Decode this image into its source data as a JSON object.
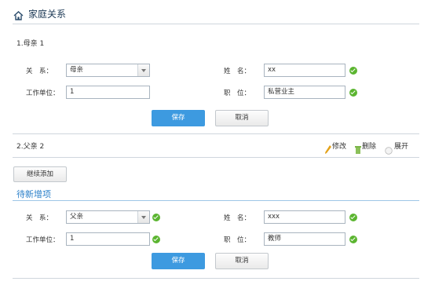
{
  "page": {
    "title": "家庭关系"
  },
  "record1": {
    "heading": "1.母亲 1",
    "relation_label": "关　系：",
    "relation_value": "母亲",
    "name_label": "姓　名：",
    "name_value": "xx",
    "work_label": "工作单位：",
    "work_value": "1",
    "position_label": "职　位：",
    "position_value": "私营业主",
    "save_label": "保存",
    "cancel_label": "取消"
  },
  "record2": {
    "heading": "2.父亲 2",
    "edit_label": "修改",
    "delete_label": "删除",
    "expand_label": "展开"
  },
  "continue_add_label": "继续添加",
  "new_section": {
    "title": "待新增项",
    "relation_label": "关　系：",
    "relation_value": "父亲",
    "name_label": "姓　名：",
    "name_value": "xxx",
    "work_label": "工作单位：",
    "work_value": "1",
    "position_label": "职　位：",
    "position_value": "教师",
    "save_label": "保存",
    "cancel_label": "取消"
  },
  "colors": {
    "primary": "#3d9ae0",
    "success": "#5bb530",
    "accent_title": "#2a7fc9"
  },
  "icons": [
    "home-icon",
    "check-icon",
    "pencil-icon",
    "trash-icon",
    "expand-icon",
    "chevron-down-icon"
  ]
}
